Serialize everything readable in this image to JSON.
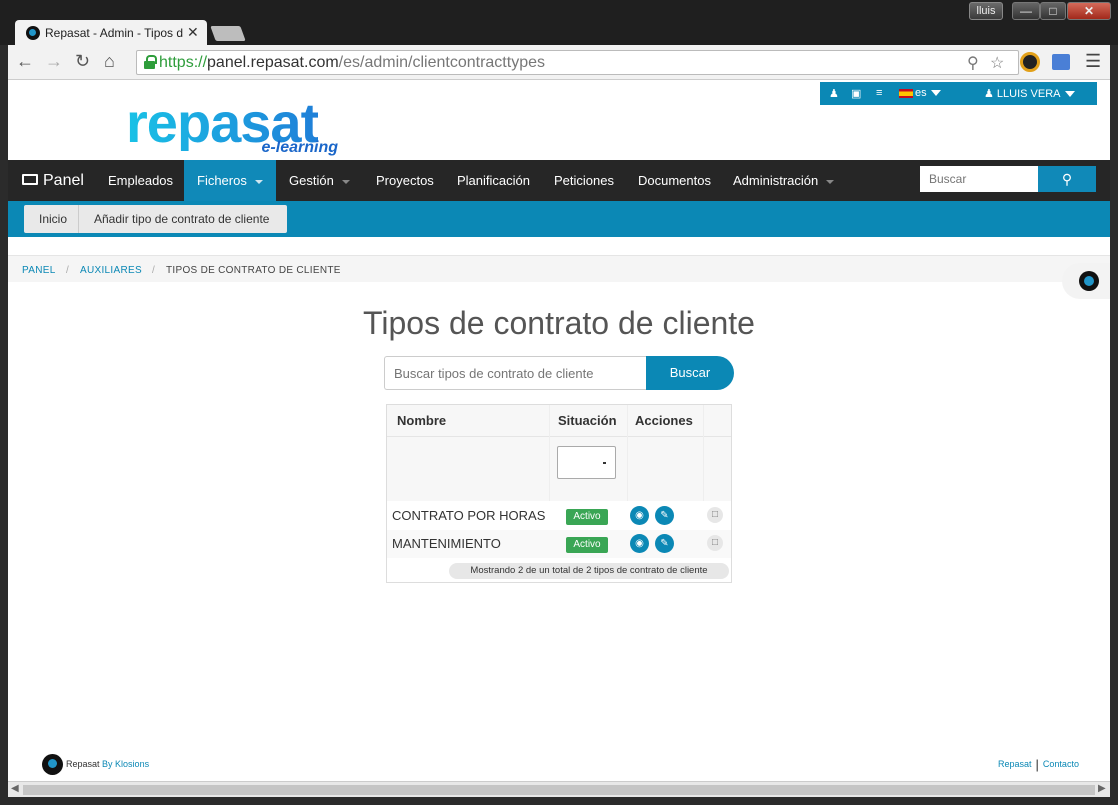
{
  "window": {
    "user_button": "lluis"
  },
  "browser": {
    "tab_title": "Repasat - Admin - Tipos de",
    "url": {
      "scheme": "https://",
      "host": "panel.repasat.com",
      "path": "/es/admin/clientcontracttypes"
    }
  },
  "topbar": {
    "language": "es",
    "user": "LLUIS VERA"
  },
  "logo": {
    "main": "repasat",
    "sub": "e-learning"
  },
  "nav": {
    "brand": "Panel",
    "items": [
      "Empleados",
      "Ficheros",
      "Gestión",
      "Proyectos",
      "Planificación",
      "Peticiones",
      "Documentos",
      "Administración"
    ],
    "search_placeholder": "Buscar"
  },
  "subnav": {
    "home": "Inicio",
    "add": "Añadir tipo de contrato de cliente"
  },
  "breadcrumb": {
    "items": [
      "PANEL",
      "AUXILIARES",
      "TIPOS DE CONTRATO DE CLIENTE"
    ]
  },
  "page": {
    "title": "Tipos de contrato de cliente",
    "search_placeholder": "Buscar tipos de contrato de cliente",
    "search_button": "Buscar"
  },
  "table": {
    "headers": [
      "Nombre",
      "Situación",
      "Acciones"
    ],
    "rows": [
      {
        "name": "CONTRATO POR HORAS",
        "status": "Activo"
      },
      {
        "name": "MANTENIMIENTO",
        "status": "Activo"
      }
    ],
    "summary": "Mostrando 2 de un total de 2 tipos de contrato de cliente"
  },
  "footer": {
    "brand": "Repasat",
    "by": "By Klosions",
    "links": [
      "Repasat",
      "Contacto"
    ]
  },
  "colors": {
    "accent": "#0b88b5",
    "navbar": "#262626",
    "active_badge": "#3aa655"
  }
}
